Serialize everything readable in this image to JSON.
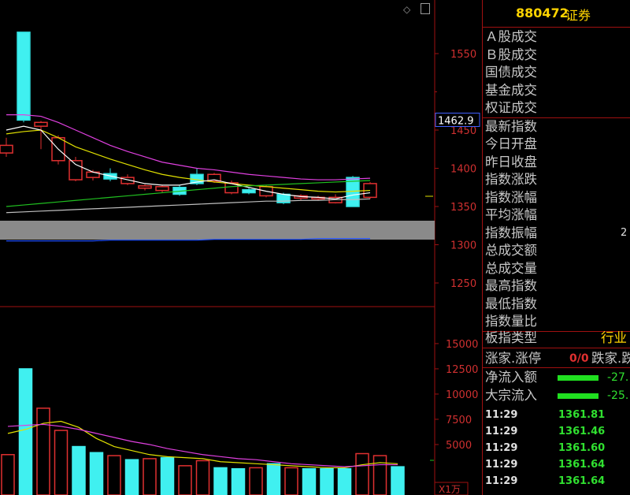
{
  "header": {
    "code": "880472",
    "name": "证券"
  },
  "price_axis": {
    "ticks": [
      "1550",
      "1450",
      "1400",
      "1350",
      "1300",
      "1250"
    ],
    "current_price": "1462.9"
  },
  "volume_axis": {
    "ticks": [
      "15000",
      "12500",
      "10000",
      "7500",
      "5000"
    ],
    "unit": "X1万"
  },
  "stats": [
    {
      "label": "Ａ股成交"
    },
    {
      "label": "Ｂ股成交"
    },
    {
      "label": "国债成交"
    },
    {
      "label": "基金成交"
    },
    {
      "label": "权证成交"
    },
    {
      "label": "最新指数"
    },
    {
      "label": "今日开盘"
    },
    {
      "label": "昨日收盘"
    },
    {
      "label": "指数涨跌"
    },
    {
      "label": "指数涨幅"
    },
    {
      "label": "平均涨幅"
    },
    {
      "label": "指数振幅",
      "value": "2"
    },
    {
      "label": "总成交额"
    },
    {
      "label": "总成交量"
    },
    {
      "label": "最高指数"
    },
    {
      "label": "最低指数"
    },
    {
      "label": "指数量比"
    }
  ],
  "industry": {
    "label": "板指类型",
    "value": "行业"
  },
  "breadth": {
    "label": "涨家.涨停",
    "ratio": "0/0",
    "fall_label": "跌家.跌"
  },
  "flows": [
    {
      "label": "净流入额",
      "value": "-27."
    },
    {
      "label": "大宗流入",
      "value": "-25."
    }
  ],
  "ticks": [
    {
      "time": "11:29",
      "price": "1361.81"
    },
    {
      "time": "11:29",
      "price": "1361.46"
    },
    {
      "time": "11:29",
      "price": "1361.60"
    },
    {
      "time": "11:29",
      "price": "1361.64"
    },
    {
      "time": "11:29",
      "price": "1361.64"
    }
  ],
  "chart_data": {
    "type": "candlestick",
    "candles": [
      {
        "open": 1430,
        "close": 1420,
        "high": 1440,
        "low": 1415
      },
      {
        "open": 1463,
        "close": 1578,
        "high": 1578,
        "low": 1460
      },
      {
        "open": 1460,
        "close": 1455,
        "high": 1462,
        "low": 1425
      },
      {
        "open": 1440,
        "close": 1410,
        "high": 1443,
        "low": 1405
      },
      {
        "open": 1410,
        "close": 1385,
        "high": 1415,
        "low": 1383
      },
      {
        "open": 1395,
        "close": 1388,
        "high": 1398,
        "low": 1384
      },
      {
        "open": 1386,
        "close": 1393,
        "high": 1400,
        "low": 1383
      },
      {
        "open": 1388,
        "close": 1380,
        "high": 1392,
        "low": 1378
      },
      {
        "open": 1377,
        "close": 1374,
        "high": 1379,
        "low": 1371
      },
      {
        "open": 1376,
        "close": 1371,
        "high": 1378,
        "low": 1368
      },
      {
        "open": 1366,
        "close": 1375,
        "high": 1378,
        "low": 1364
      },
      {
        "open": 1380,
        "close": 1392,
        "high": 1400,
        "low": 1378
      },
      {
        "open": 1392,
        "close": 1383,
        "high": 1394,
        "low": 1381
      },
      {
        "open": 1381,
        "close": 1368,
        "high": 1384,
        "low": 1366
      },
      {
        "open": 1368,
        "close": 1372,
        "high": 1374,
        "low": 1366
      },
      {
        "open": 1376,
        "close": 1364,
        "high": 1378,
        "low": 1362
      },
      {
        "open": 1355,
        "close": 1366,
        "high": 1368,
        "low": 1353
      },
      {
        "open": 1364,
        "close": 1361,
        "high": 1366,
        "low": 1358
      },
      {
        "open": 1362,
        "close": 1360,
        "high": 1364,
        "low": 1358
      },
      {
        "open": 1362,
        "close": 1355,
        "high": 1366,
        "low": 1354
      },
      {
        "open": 1350,
        "close": 1388,
        "high": 1390,
        "low": 1350
      },
      {
        "open": 1380,
        "close": 1362,
        "high": 1382,
        "low": 1360
      }
    ],
    "ma_series": [
      {
        "color": "#e040e0",
        "values": [
          1470,
          1470,
          1468,
          1460,
          1450,
          1440,
          1430,
          1422,
          1415,
          1408,
          1404,
          1400,
          1398,
          1395,
          1392,
          1390,
          1388,
          1386,
          1385,
          1385,
          1386,
          1387
        ]
      },
      {
        "color": "#e0e000",
        "values": [
          1445,
          1448,
          1450,
          1440,
          1428,
          1420,
          1412,
          1405,
          1398,
          1392,
          1388,
          1385,
          1382,
          1380,
          1378,
          1376,
          1374,
          1372,
          1370,
          1369,
          1370,
          1371
        ]
      },
      {
        "color": "#ffffff",
        "values": [
          1450,
          1455,
          1450,
          1425,
          1405,
          1395,
          1390,
          1385,
          1380,
          1378,
          1378,
          1382,
          1385,
          1380,
          1375,
          1370,
          1366,
          1363,
          1362,
          1360,
          1365,
          1368
        ]
      },
      {
        "color": "#20c020",
        "values": [
          1350,
          1352,
          1354,
          1356,
          1358,
          1360,
          1362,
          1364,
          1366,
          1368,
          1370,
          1372,
          1374,
          1376,
          1377,
          1378,
          1379,
          1380,
          1381,
          1382,
          1383,
          1384
        ]
      },
      {
        "color": "#c0c0c0",
        "values": [
          1342,
          1343,
          1344,
          1345,
          1346,
          1347,
          1348,
          1349,
          1350,
          1351,
          1352,
          1353,
          1354,
          1355,
          1356,
          1357,
          1357,
          1358,
          1358,
          1359,
          1359,
          1360
        ]
      },
      {
        "color": "#2050ff",
        "values": [
          1305,
          1305,
          1305,
          1305,
          1305,
          1305,
          1306,
          1306,
          1306,
          1306,
          1306,
          1306,
          1307,
          1307,
          1307,
          1307,
          1307,
          1307,
          1308,
          1308,
          1308,
          1308
        ]
      }
    ],
    "volumes": [
      {
        "value": 4000,
        "up": false
      },
      {
        "value": 12500,
        "up": true
      },
      {
        "value": 8600,
        "up": false
      },
      {
        "value": 6400,
        "up": false
      },
      {
        "value": 4800,
        "up": true
      },
      {
        "value": 4200,
        "up": true
      },
      {
        "value": 3900,
        "up": false
      },
      {
        "value": 3500,
        "up": true
      },
      {
        "value": 3600,
        "up": false
      },
      {
        "value": 3700,
        "up": true
      },
      {
        "value": 2900,
        "up": false
      },
      {
        "value": 3400,
        "up": false
      },
      {
        "value": 2700,
        "up": true
      },
      {
        "value": 2600,
        "up": true
      },
      {
        "value": 2700,
        "up": false
      },
      {
        "value": 3100,
        "up": true
      },
      {
        "value": 2700,
        "up": false
      },
      {
        "value": 2600,
        "up": true
      },
      {
        "value": 2600,
        "up": true
      },
      {
        "value": 2600,
        "up": true
      },
      {
        "value": 4100,
        "up": false
      },
      {
        "value": 3900,
        "up": false
      },
      {
        "value": 2800,
        "up": true
      }
    ],
    "vol_ma": [
      {
        "color": "#e0e000",
        "values": [
          6100,
          6500,
          7100,
          7300,
          6700,
          5600,
          4800,
          4400,
          4000,
          3800,
          3700,
          3600,
          3300,
          3200,
          3100,
          3000,
          2900,
          2800,
          2700,
          2700,
          3000,
          3200,
          3100
        ]
      },
      {
        "color": "#e040e0",
        "values": [
          6800,
          6900,
          7000,
          6800,
          6500,
          6100,
          5700,
          5300,
          5000,
          4600,
          4300,
          4000,
          3800,
          3600,
          3500,
          3300,
          3100,
          3000,
          2900,
          2800,
          2900,
          3000,
          3000
        ]
      }
    ],
    "price_range": [
      1200,
      1600
    ],
    "volume_range": [
      0,
      17000
    ]
  }
}
